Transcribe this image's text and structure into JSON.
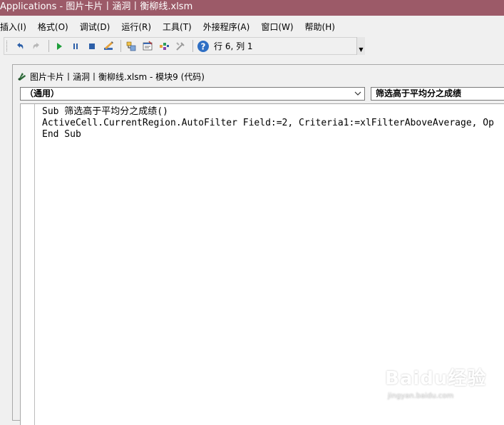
{
  "window": {
    "title": "Applications - 图片卡片丨涵洞丨衡柳线.xlsm"
  },
  "menu": {
    "items": [
      "插入(I)",
      "格式(O)",
      "调试(D)",
      "运行(R)",
      "工具(T)",
      "外接程序(A)",
      "窗口(W)",
      "帮助(H)"
    ]
  },
  "toolbar": {
    "icons": [
      "undo-icon",
      "redo-icon",
      "run-icon",
      "pause-icon",
      "stop-icon",
      "design-mode-icon",
      "project-explorer-icon",
      "properties-icon",
      "object-browser-icon",
      "toolbox-icon",
      "help-icon"
    ],
    "cursor_position": "行 6, 列 1"
  },
  "code_window": {
    "title": "图片卡片丨涵洞丨衡柳线.xlsm - 模块9 (代码)",
    "object_combo": "（通用）",
    "procedure_combo": "筛选高于平均分之成绩",
    "code_lines": [
      "Sub 筛选高于平均分之成绩()",
      "ActiveCell.CurrentRegion.AutoFilter Field:=2, Criteria1:=xlFilterAboveAverage, Op",
      "End Sub"
    ]
  },
  "watermark": {
    "text": "Baidu经验",
    "sub": "jingyan.baidu.com"
  },
  "colors": {
    "titlebar": "#9c5a68",
    "editor_bg": "#ffffff",
    "chrome_bg": "#f0f0f0"
  }
}
